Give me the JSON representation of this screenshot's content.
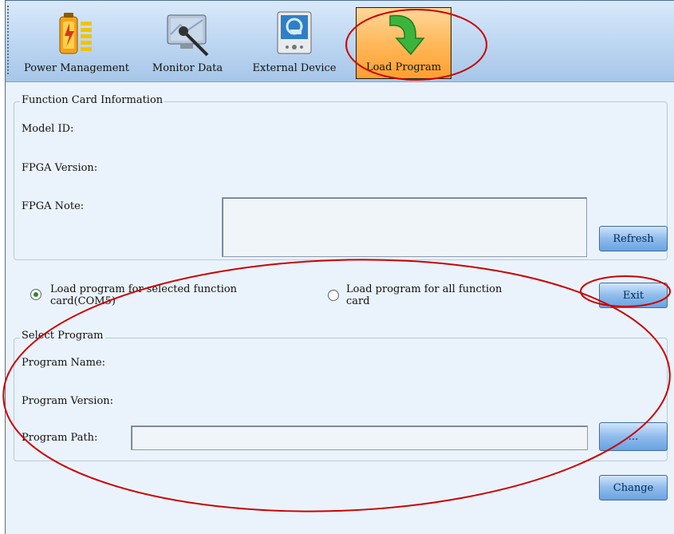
{
  "toolbar": {
    "items": [
      {
        "label": "Power Management",
        "icon": "battery-icon",
        "active": false
      },
      {
        "label": "Monitor Data",
        "icon": "monitor-icon",
        "active": false
      },
      {
        "label": "External Device",
        "icon": "device-icon",
        "active": false
      },
      {
        "label": "Load Program",
        "icon": "load-arrow-icon",
        "active": true
      }
    ]
  },
  "card_info": {
    "legend": "Function Card Information",
    "model_id_label": "Model ID:",
    "fpga_version_label": "FPGA Version:",
    "fpga_note_label": "FPGA Note:",
    "fpga_note_value": "",
    "refresh_label": "Refresh"
  },
  "load_mode": {
    "selected_label_line1": "Load program for selected function",
    "selected_label_line2": "card(COM5)",
    "all_label_line1": "Load program for all function",
    "all_label_line2": "card",
    "selected": "selected",
    "exit_label": "Exit"
  },
  "select_program": {
    "legend": "Select Program",
    "name_label": "Program Name:",
    "version_label": "Program Version:",
    "path_label": "Program Path:",
    "path_value": "",
    "browse_label": "...",
    "change_label": "Change"
  },
  "colors": {
    "active_tab": "#ff9f2f",
    "button": "#6aa3e0",
    "annotation": "#cc0000"
  }
}
